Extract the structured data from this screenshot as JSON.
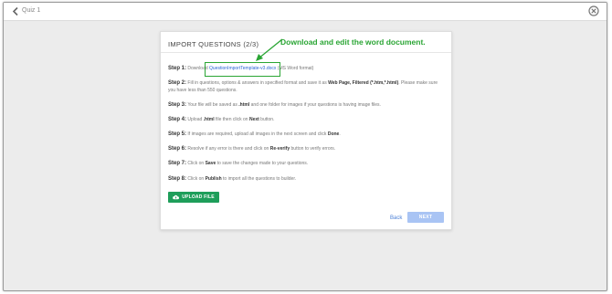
{
  "window": {
    "title": "Quiz 1"
  },
  "modal": {
    "title": "IMPORT QUESTIONS (2/3)",
    "annotation": "Download and edit the word document.",
    "steps": [
      {
        "label": "Step 1:",
        "pre": "Download ",
        "link": "QuestionImportTemplate-v3.docx",
        "post": " (MS Word format)"
      },
      {
        "label": "Step 2:",
        "pre": "Fill in questions, options & answers in specified format and save it as ",
        "em1": "Web Page, Filtered (*.htm,*.html)",
        "post": ". Please make sure you have less than 550 questions."
      },
      {
        "label": "Step 3:",
        "pre": "Your file will be saved as ",
        "em1": ".html",
        "post": " and one folder for images if your questions is having image files."
      },
      {
        "label": "Step 4:",
        "pre": "Upload ",
        "em1": ".html",
        "mid": " file then click on ",
        "em2": "Next",
        "post": " button."
      },
      {
        "label": "Step 5:",
        "pre": "If images are required, upload all images in the next screen and click ",
        "em1": "Done",
        "post": "."
      },
      {
        "label": "Step 6:",
        "pre": "Resolve if any error is there and click on ",
        "em1": "Re-verify",
        "post": " button to verify errors."
      },
      {
        "label": "Step 7:",
        "pre": "Click on ",
        "em1": "Save",
        "post": " to save the changes made to your questions."
      },
      {
        "label": "Step 8:",
        "pre": "Click on ",
        "em1": "Publish",
        "post": " to import all the questions to builder."
      }
    ],
    "upload_label": "UPLOAD FILE",
    "back_label": "Back",
    "next_label": "NEXT"
  },
  "colors": {
    "accent_green": "#2aa534",
    "upload_button": "#1e9e5a",
    "next_disabled": "#a9c4f4",
    "link_blue": "#2a64d5"
  },
  "icons": {
    "back": "chevron-left-icon",
    "close": "close-circle-icon",
    "upload": "cloud-upload-icon",
    "arrow": "annotation-arrow-icon"
  }
}
